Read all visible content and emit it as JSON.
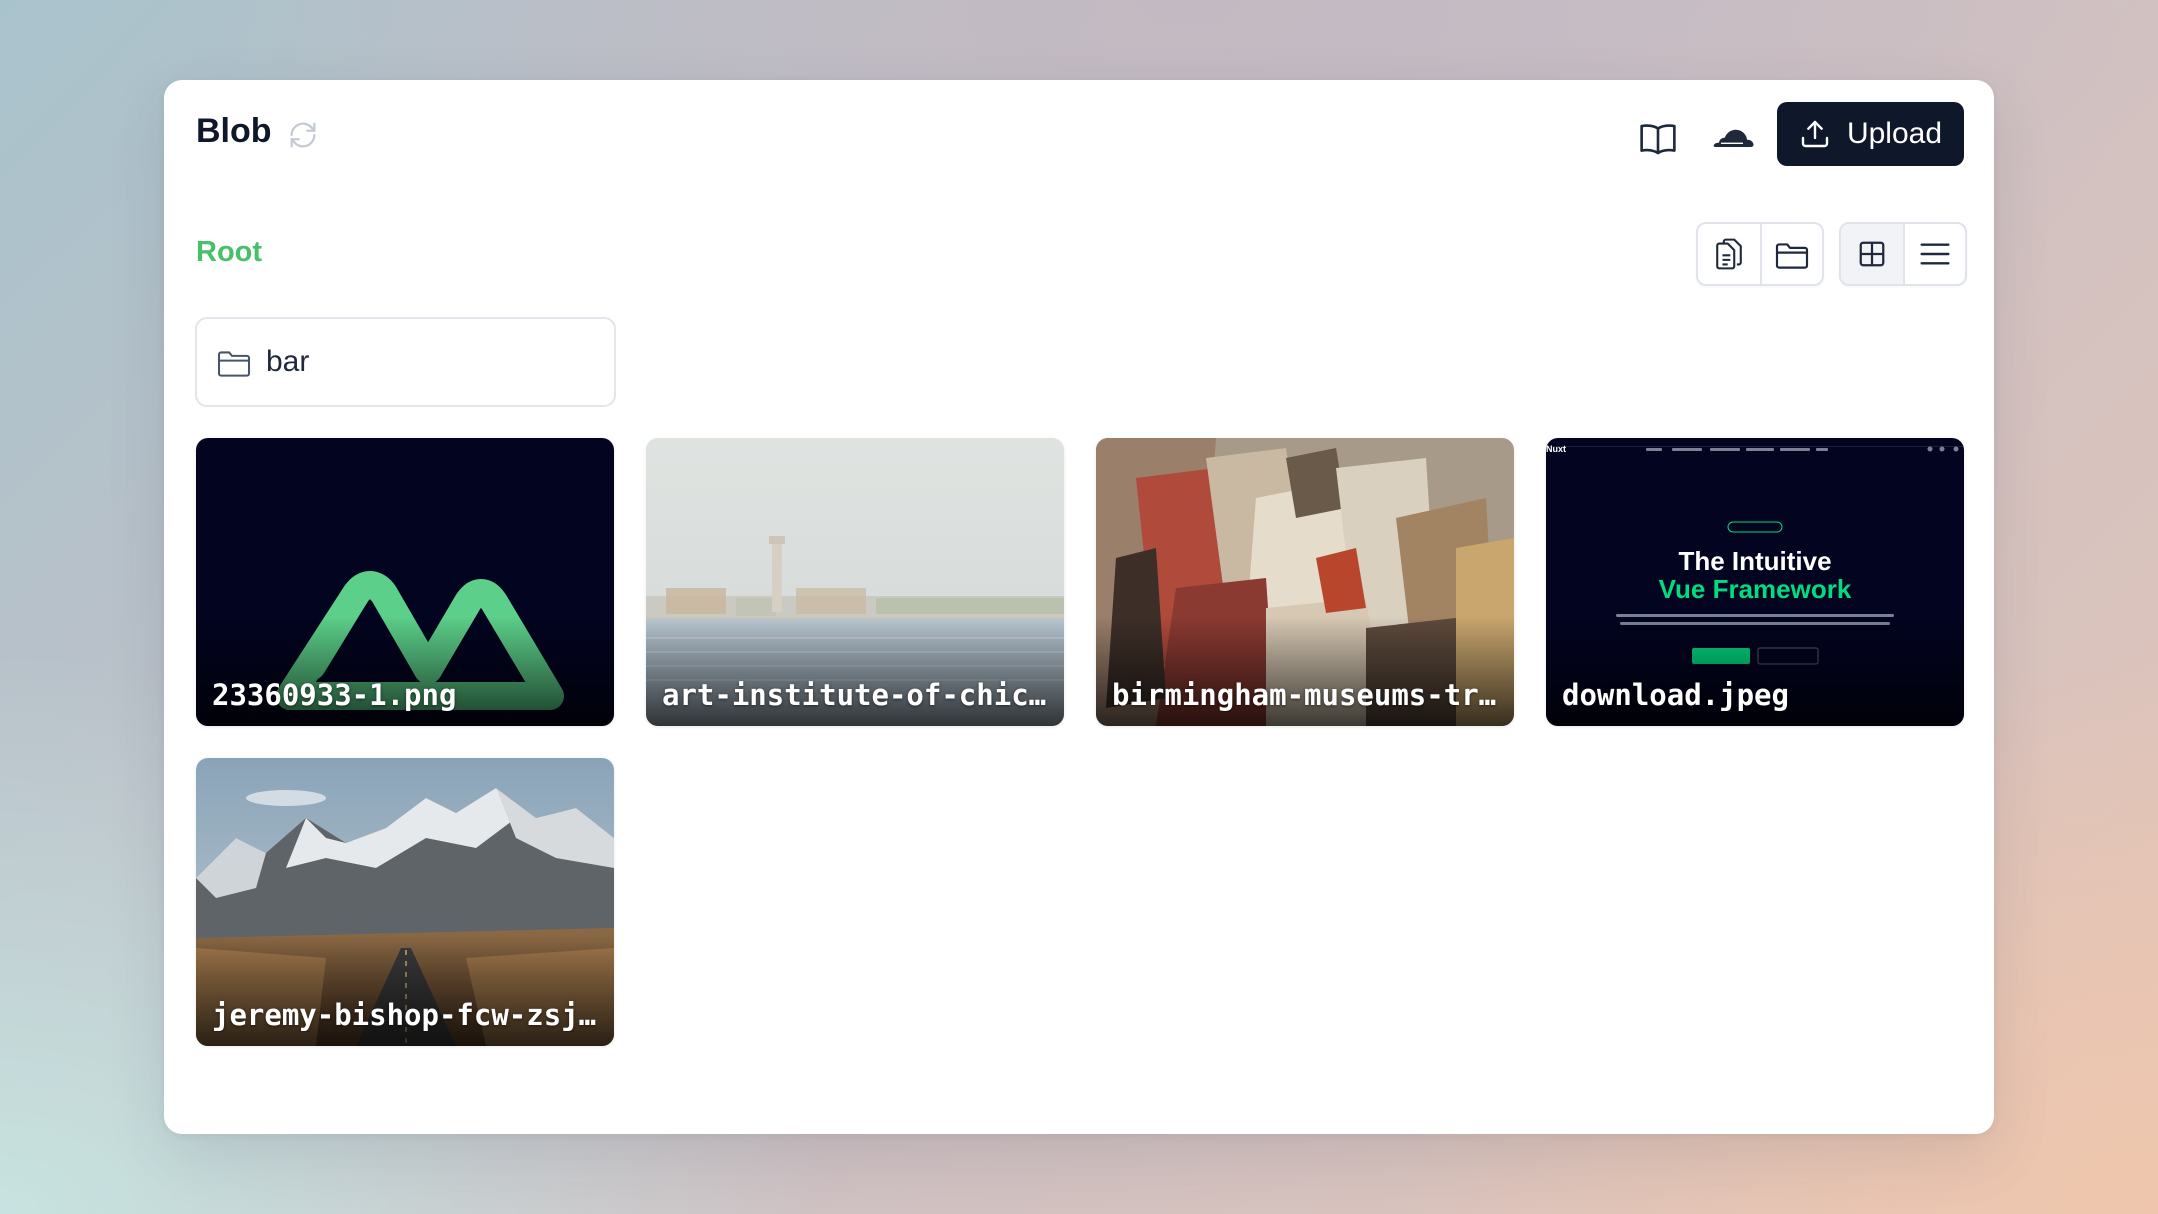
{
  "header": {
    "title": "Blob",
    "upload_label": "Upload"
  },
  "toolbar": {
    "icons": {
      "refresh": "refresh-icon",
      "docs": "book-open-icon",
      "cloud": "cloudflare-icon",
      "upload": "upload-icon",
      "new_file": "document-duplicate-icon",
      "new_folder": "folder-icon",
      "grid_view": "grid-icon",
      "list_view": "list-icon"
    },
    "active_view": "grid"
  },
  "breadcrumb": {
    "root": "Root"
  },
  "folders": [
    {
      "name": "bar"
    }
  ],
  "files": [
    {
      "name": "23360933-1.png"
    },
    {
      "name": "art-institute-of-chic…"
    },
    {
      "name": "birmingham-museums-tr…"
    },
    {
      "name": "download.jpeg"
    },
    {
      "name": "jeremy-bishop-fcw-zsj…"
    }
  ],
  "preview_download": {
    "heading_line1": "The Intuitive",
    "heading_line2": "Vue Framework",
    "logo_text": "Nuxt"
  },
  "colors": {
    "accent": "#48c06a",
    "primary_button": "#0f172a",
    "nuxt_green": "#00dc82",
    "nuxt_bg": "#020420"
  }
}
